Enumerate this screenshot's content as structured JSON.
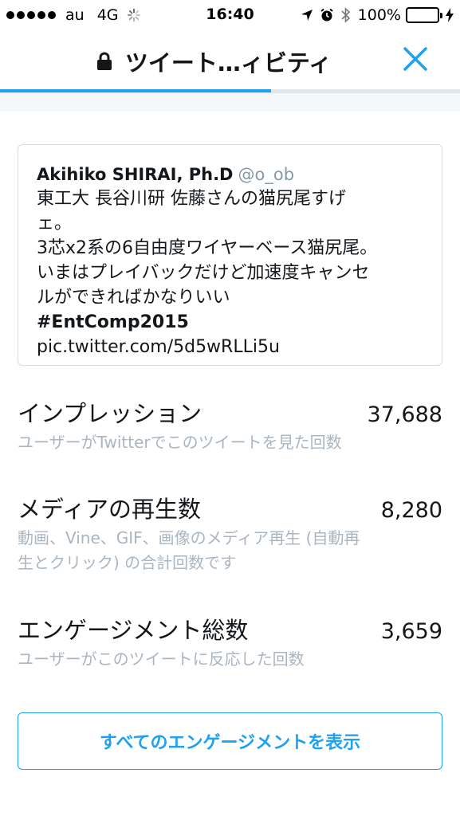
{
  "status_bar": {
    "carrier": "au",
    "network": "4G",
    "time": "16:40",
    "battery": "100%",
    "battery_level": 1.0,
    "icons": [
      "signal-dots",
      "loading-spinner",
      "location-arrow-icon",
      "alarm-icon",
      "bluetooth-icon",
      "battery-icon",
      "charging-bolt-icon"
    ]
  },
  "nav": {
    "title": "ツイート…ィビティ",
    "lock_icon": "lock-icon",
    "close_icon": "close-icon",
    "progress": 0.59,
    "accent_color": "#1da1f2"
  },
  "tweet": {
    "author_name": "Akihiko SHIRAI, Ph.D",
    "author_handle": "@o_ob",
    "lines": [
      "東工大 長谷川研 佐藤さんの猫尻尾すげ",
      "ェ。",
      "3芯x2系の6自由度ワイヤーベース猫尻尾。",
      "いまはプレイバックだけど加速度キャンセ",
      "ルができればかなりいい"
    ],
    "hashtag": "#EntComp2015",
    "link": "pic.twitter.com/5d5wRLLi5u"
  },
  "metrics": [
    {
      "label": "インプレッション",
      "value": "37,688",
      "desc_lines": [
        "ユーザーがTwitterでこのツイートを見た回数"
      ]
    },
    {
      "label": "メディアの再生数",
      "value": "8,280",
      "desc_lines": [
        "動画、Vine、GIF、画像のメディア再生 (自動再",
        "生とクリック) の合計回数です"
      ]
    },
    {
      "label": "エンゲージメント総数",
      "value": "3,659",
      "desc_lines": [
        "ユーザーがこのツイートに反応した回数"
      ]
    }
  ],
  "engagement_button": "すべてのエンゲージメントを表示"
}
